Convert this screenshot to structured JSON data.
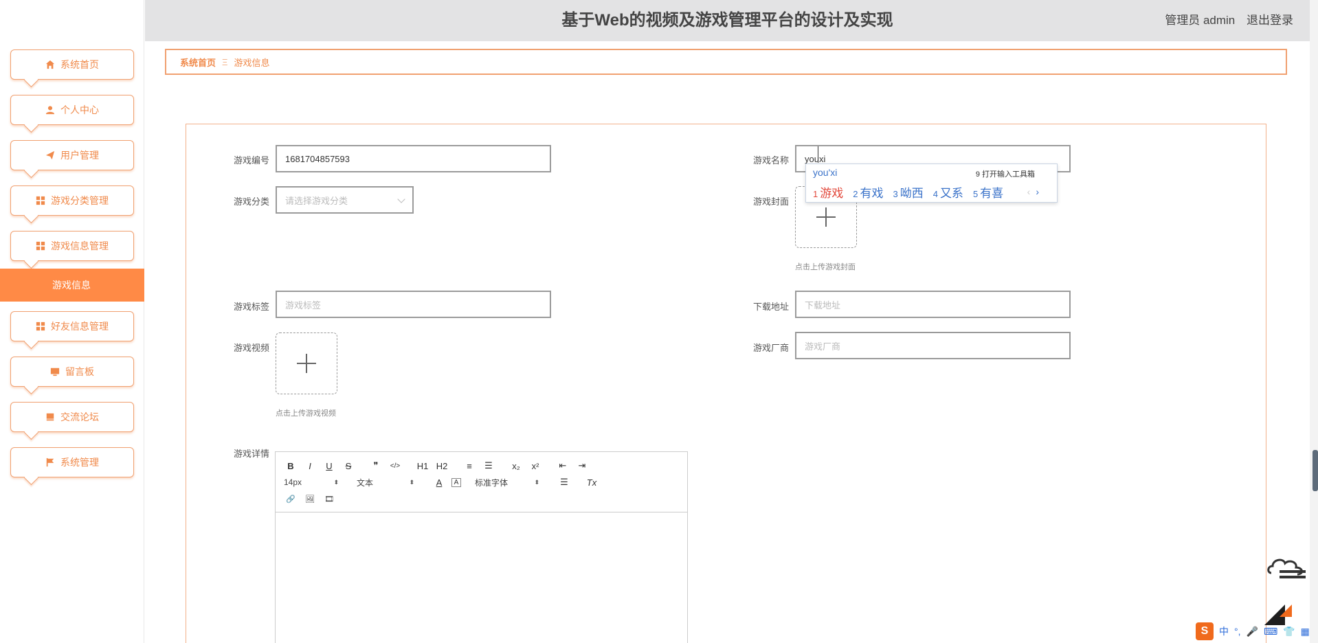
{
  "header": {
    "title": "基于Web的视频及游戏管理平台的设计及实现",
    "user": "管理员 admin",
    "logout": "退出登录"
  },
  "sidebar": {
    "items": [
      {
        "label": "系统首页",
        "icon": "home-icon"
      },
      {
        "label": "个人中心",
        "icon": "user-icon"
      },
      {
        "label": "用户管理",
        "icon": "send-icon"
      },
      {
        "label": "游戏分类管理",
        "icon": "grid-icon"
      },
      {
        "label": "游戏信息管理",
        "icon": "grid-icon"
      },
      {
        "label": "好友信息管理",
        "icon": "grid-icon"
      },
      {
        "label": "留言板",
        "icon": "monitor-icon"
      },
      {
        "label": "交流论坛",
        "icon": "chat-icon"
      },
      {
        "label": "系统管理",
        "icon": "flag-icon"
      }
    ],
    "active_sub": "游戏信息"
  },
  "breadcrumb": {
    "home": "系统首页",
    "sep": "Ξ",
    "current": "游戏信息"
  },
  "form": {
    "game_id_label": "游戏编号",
    "game_id_value": "1681704857593",
    "game_name_label": "游戏名称",
    "game_name_value": "youxi",
    "category_label": "游戏分类",
    "category_placeholder": "请选择游戏分类",
    "cover_label": "游戏封面",
    "cover_hint": "点击上传游戏封面",
    "tags_label": "游戏标签",
    "tags_placeholder": "游戏标签",
    "download_label": "下载地址",
    "download_placeholder": "下载地址",
    "video_label": "游戏视频",
    "video_hint": "点击上传游戏视频",
    "vendor_label": "游戏厂商",
    "vendor_placeholder": "游戏厂商",
    "detail_label": "游戏详情"
  },
  "editor": {
    "row1": [
      "B",
      "I",
      "U",
      "S",
      "❞",
      "</>",
      "H1",
      "H2",
      "≡",
      "☰",
      "x₂",
      "x²",
      "⇤",
      "⇥"
    ],
    "font_size": "14px",
    "text_type": "文本",
    "font_family": "标准字体",
    "clear": "Tx",
    "row3": [
      "🔗",
      "🖼",
      "🎞"
    ]
  },
  "ime": {
    "pinyin": "you'xi",
    "toolbox": "9 打开输入工具箱",
    "candidates": [
      {
        "n": "1",
        "w": "游戏"
      },
      {
        "n": "2",
        "w": "有戏"
      },
      {
        "n": "3",
        "w": "呦西"
      },
      {
        "n": "4",
        "w": "又系"
      },
      {
        "n": "5",
        "w": "有喜"
      }
    ],
    "prev": "‹",
    "next": "›"
  },
  "tray": {
    "logo": "S",
    "items": [
      "中",
      "°,",
      "🎤",
      "⌨",
      "👕",
      "▦"
    ]
  },
  "colors": {
    "accent": "#ff8a46",
    "border": "#f0a070",
    "header_bg": "#e3e3e4"
  }
}
